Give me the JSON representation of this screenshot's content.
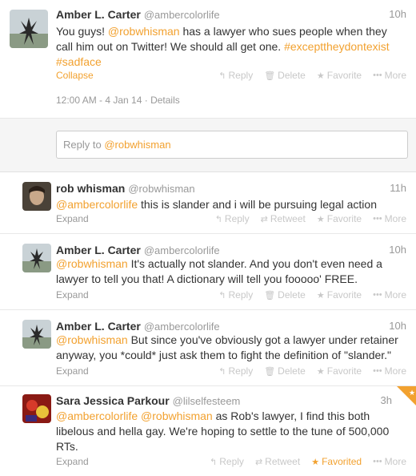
{
  "tweets": [
    {
      "name": "Amber L. Carter",
      "handle": "@ambercolorlife",
      "time": "10h",
      "text_parts": [
        "You guys! ",
        "@robwhisman",
        " has a lawyer who sues people when they call him out on Twitter! We should all get one. ",
        "#excepttheydontexist",
        " ",
        "#sadface"
      ],
      "expand_label": "Collapse",
      "actions": [
        "Reply",
        "Delete",
        "Favorite",
        "More"
      ],
      "timestamp": "12:00 AM - 4 Jan 14 · Details"
    },
    {
      "name": "rob whisman",
      "handle": "@robwhisman",
      "time": "11h",
      "text_parts": [
        "@ambercolorlife",
        " this is slander and i will be pursuing legal action"
      ],
      "expand_label": "Expand",
      "actions": [
        "Reply",
        "Retweet",
        "Favorite",
        "More"
      ]
    },
    {
      "name": "Amber L. Carter",
      "handle": "@ambercolorlife",
      "time": "10h",
      "text_parts": [
        "@robwhisman",
        " It's actually not slander. And you don't even need a lawyer to tell you that! A dictionary will tell you fooooo'  FREE."
      ],
      "expand_label": "Expand",
      "actions": [
        "Reply",
        "Delete",
        "Favorite",
        "More"
      ]
    },
    {
      "name": "Amber L. Carter",
      "handle": "@ambercolorlife",
      "time": "10h",
      "text_parts": [
        "@robwhisman",
        " But since you've obviously got a lawyer under retainer anyway, you *could* just ask them to fight the definition of \"slander.\""
      ],
      "expand_label": "Expand",
      "actions": [
        "Reply",
        "Delete",
        "Favorite",
        "More"
      ]
    },
    {
      "name": "Sara Jessica Parkour",
      "handle": "@lilselfesteem",
      "time": "3h",
      "text_parts": [
        "@ambercolorlife",
        " ",
        "@robwhisman",
        " as Rob's lawyer, I find this both libelous and hella gay. We're hoping to settle to the tune of 500,000 RTs."
      ],
      "expand_label": "Expand",
      "actions": [
        "Reply",
        "Retweet",
        "Favorited",
        "More"
      ]
    }
  ],
  "reply": {
    "prefix": "Reply to ",
    "mention": "@robwhisman"
  },
  "colors": {
    "accent": "#f2a12f",
    "muted": "#999999",
    "border": "#e8e8e8"
  }
}
